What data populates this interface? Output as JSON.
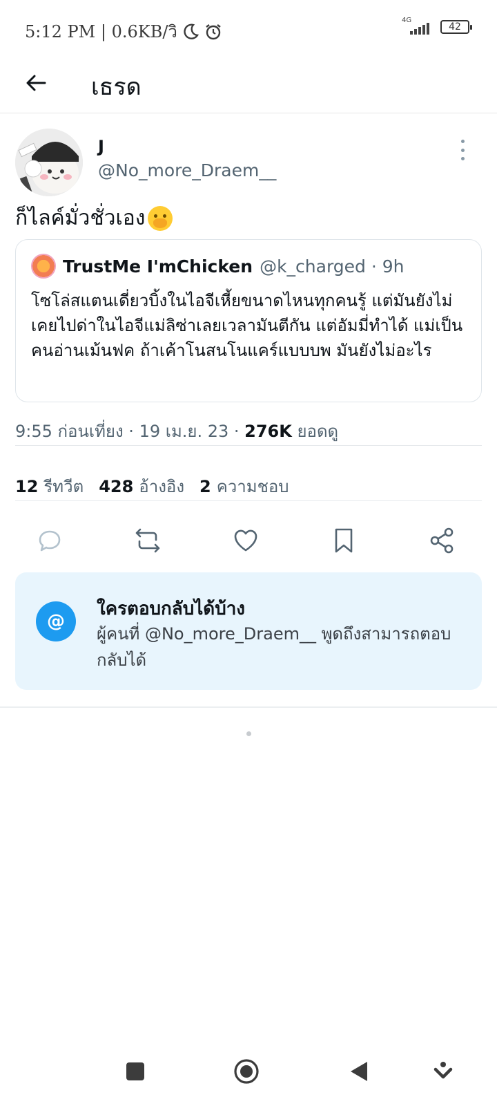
{
  "status_bar": {
    "time_network": "5:12 PM | 0.6KB/วิ",
    "network_type": "4G",
    "battery": "42",
    "icons": [
      "moon-icon",
      "alarm-icon",
      "signal-icon",
      "battery-icon"
    ]
  },
  "header": {
    "back_icon": "arrow-left-icon",
    "title": "เธรด"
  },
  "tweet": {
    "display_name": "J",
    "handle": "@No_more_Draem__",
    "text": "ก็ไลค์มั่วชั่วเอง",
    "emoji": "face-with-hand-over-mouth",
    "quote": {
      "name": "TrustMe I'mChicken",
      "handle_time": "@k_charged · 9h",
      "text": "โซโล่สแตนเดี่ยวบิ้งในไอจีเหี้ยขนาดไหนทุกคนรู้ แต่มันยังไม่เคยไปด่าในไอจีแม่ลิซ่าเลยเวลามันตีกัน แต่อัมมี่ทำได้ แม่เป็นคนอ่านเม้นฟค ถ้าเค้าโนสนโนแคร์แบบบพ มันยังไม่อะไร"
    },
    "meta": {
      "time_date": "9:55 ก่อนเที่ยง · 19 เม.ย. 23 · ",
      "views_count": "276K",
      "views_label": " ยอดดู"
    },
    "stats": {
      "retweets": "12",
      "retweets_label": "รีทวีต",
      "quotes": "428",
      "quotes_label": "อ้างอิง",
      "likes": "2",
      "likes_label": "ความชอบ"
    }
  },
  "reply_restriction": {
    "icon": "@",
    "title": "ใครตอบกลับได้บ้าง",
    "description": "ผู้คนที่ @No_more_Draem__ พูดถึงสามารถตอบกลับได้"
  },
  "colors": {
    "accent": "#1d9bf0",
    "secondary_text": "#536471",
    "reply_box_bg": "#e8f5fd"
  }
}
